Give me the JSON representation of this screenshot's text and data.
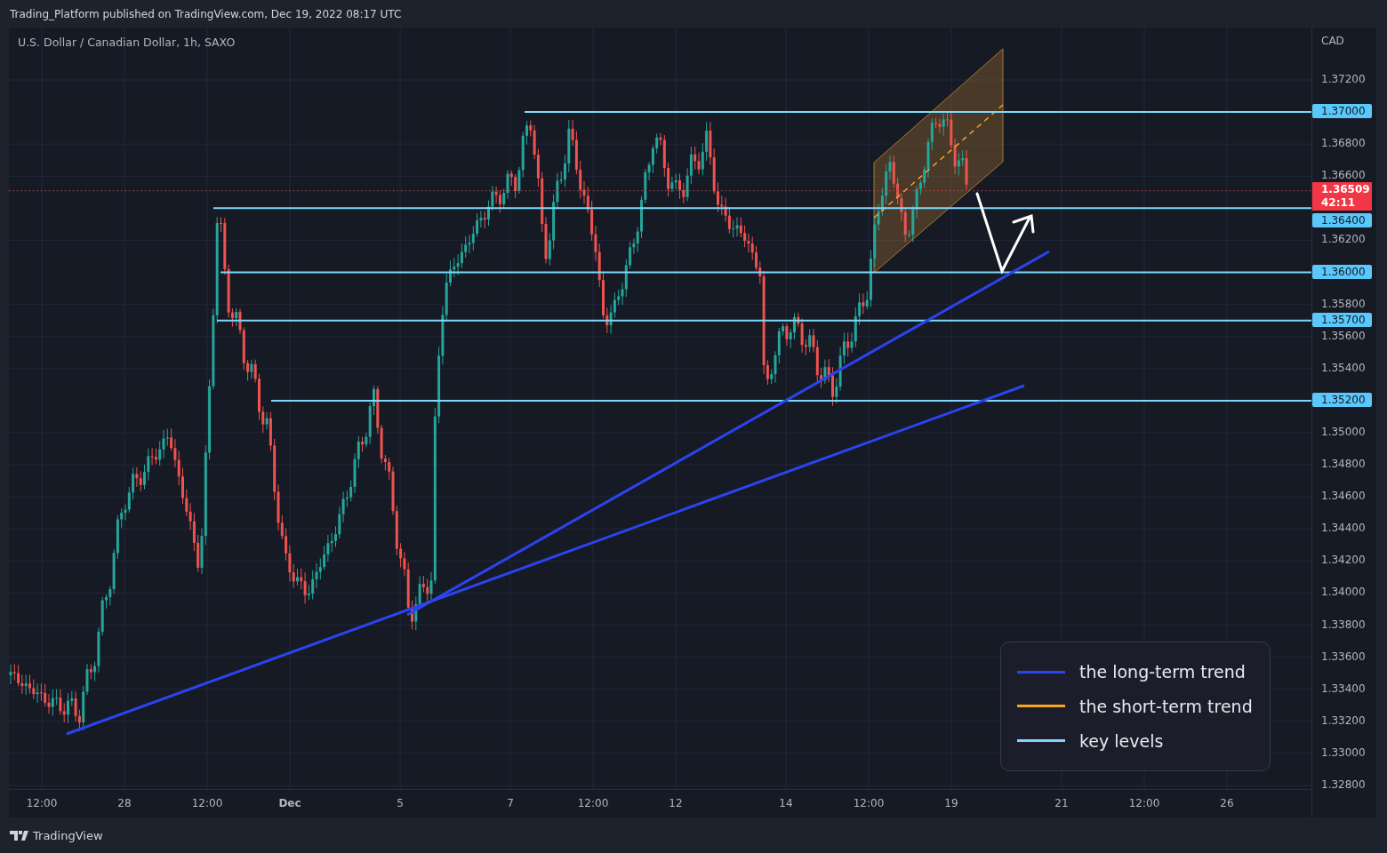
{
  "header": {
    "publisher": "Trading_Platform published on TradingView.com, Dec 19, 2022 08:17 UTC"
  },
  "chart": {
    "symbol": "U.S. Dollar / Canadian Dollar, 1h, SAXO",
    "currency": "CAD",
    "price_ticks": [
      "1.37200",
      "1.36800",
      "1.36600",
      "1.36200",
      "1.35800",
      "1.35600",
      "1.35400",
      "1.35000",
      "1.34800",
      "1.34600",
      "1.34400",
      "1.34200",
      "1.34000",
      "1.33800",
      "1.33600",
      "1.33400",
      "1.33200",
      "1.33000",
      "1.32800"
    ],
    "key_levels": [
      {
        "price": "1.37000"
      },
      {
        "price": "1.36400"
      },
      {
        "price": "1.36000"
      },
      {
        "price": "1.35700"
      },
      {
        "price": "1.35200"
      }
    ],
    "current_price": {
      "price": "1.36509",
      "countdown": "42:11"
    },
    "time_ticks": [
      {
        "label": "12:00",
        "bold": false
      },
      {
        "label": "28",
        "bold": false
      },
      {
        "label": "12:00",
        "bold": false
      },
      {
        "label": "Dec",
        "bold": true
      },
      {
        "label": "5",
        "bold": false
      },
      {
        "label": "7",
        "bold": false
      },
      {
        "label": "12:00",
        "bold": false
      },
      {
        "label": "12",
        "bold": false
      },
      {
        "label": "14",
        "bold": false
      },
      {
        "label": "12:00",
        "bold": false
      },
      {
        "label": "19",
        "bold": false
      },
      {
        "label": "21",
        "bold": false
      },
      {
        "label": "12:00",
        "bold": false
      },
      {
        "label": "26",
        "bold": false
      }
    ],
    "legend": {
      "items": [
        {
          "label": "the long-term trend",
          "color": "#2a44ee"
        },
        {
          "label": "the short-term trend",
          "color": "#f5a623"
        },
        {
          "label": "key levels",
          "color": "#7fd8fb"
        }
      ]
    }
  },
  "footer": {
    "brand": "TradingView"
  }
}
